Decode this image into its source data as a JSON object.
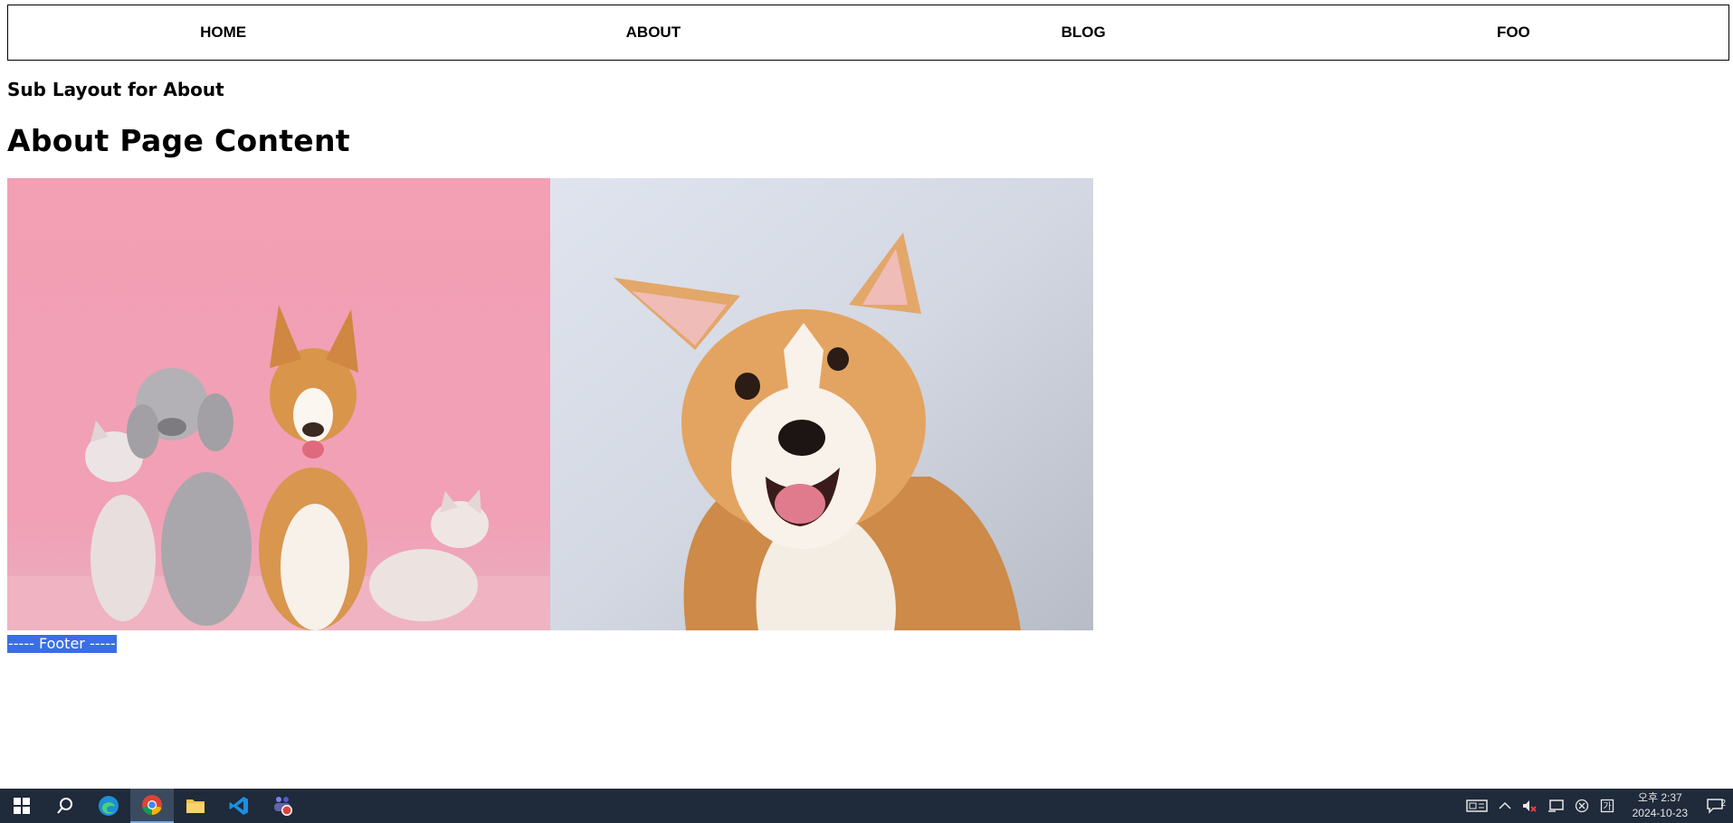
{
  "nav": {
    "items": [
      {
        "label": "HOME"
      },
      {
        "label": "ABOUT"
      },
      {
        "label": "BLOG"
      },
      {
        "label": "FOO"
      }
    ]
  },
  "content": {
    "sub_layout_title": "Sub Layout for About",
    "page_title": "About Page Content",
    "images": [
      {
        "name": "cats-and-dogs-group-photo"
      },
      {
        "name": "corgi-portrait-photo"
      }
    ]
  },
  "footer": {
    "text": "----- Footer -----"
  },
  "taskbar": {
    "apps": [
      "windows-start-icon",
      "search-icon",
      "edge-icon",
      "chrome-icon",
      "file-explorer-icon",
      "vscode-icon",
      "teams-icon"
    ],
    "tray": {
      "time": "오후 2:37",
      "date": "2024-10-23",
      "notification_count": "2"
    }
  },
  "colors": {
    "footer_highlight": "#3a6ee6",
    "taskbar_bg": "#1f2a3a"
  }
}
